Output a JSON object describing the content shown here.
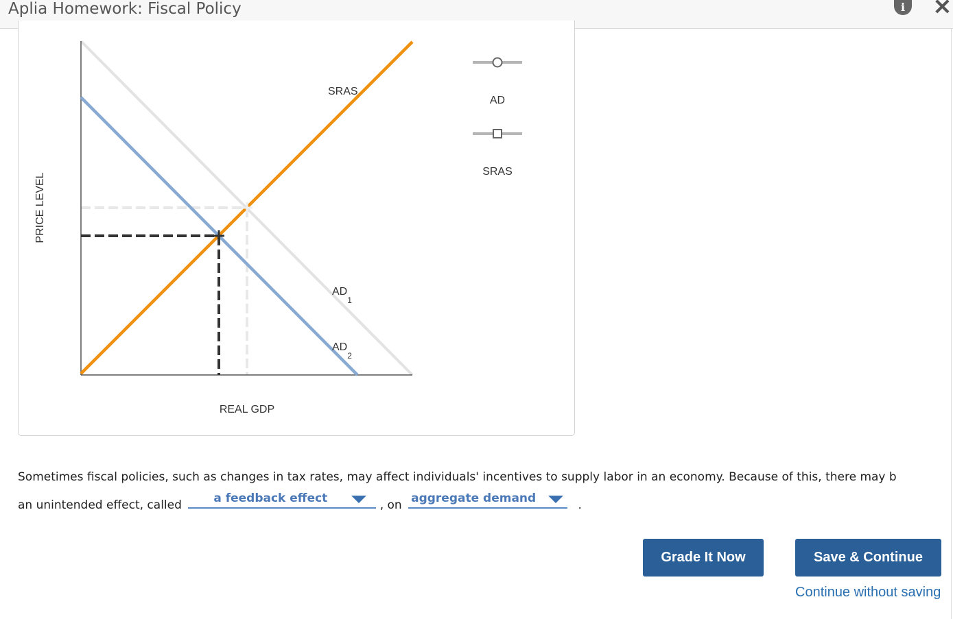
{
  "window": {
    "title": "Aplia Homework: Fiscal Policy",
    "info_icon": "info-icon",
    "close_icon": "close-icon"
  },
  "graph": {
    "y_axis_label": "PRICE LEVEL",
    "x_axis_label": "REAL GDP",
    "curve_labels": {
      "sras": "SRAS",
      "ad1_main": "AD",
      "ad1_sub": "1",
      "ad2_main": "AD",
      "ad2_sub": "2"
    },
    "legend": [
      {
        "label": "AD",
        "marker": "circle"
      },
      {
        "label": "SRAS",
        "marker": "square"
      }
    ],
    "colors": {
      "sras": "#f0900f",
      "ad2": "#87a9d2",
      "ad1": "#e3e3e3",
      "old_equilibrium": "#e8e8e8",
      "new_equilibrium": "#333333",
      "legend": "#b5b5b5"
    }
  },
  "question": {
    "text_before": "Sometimes fiscal policies, such as changes in tax rates, may affect individuals' incentives to supply labor in an economy. Because of this, there may b",
    "text_line2_start": "an unintended effect, called",
    "dropdown1_value": "a feedback effect",
    "text_middle": ", on",
    "dropdown2_value": "aggregate demand",
    "text_end": "."
  },
  "buttons": {
    "grade": "Grade It Now",
    "save": "Save & Continue",
    "continue_link": "Continue without saving"
  }
}
